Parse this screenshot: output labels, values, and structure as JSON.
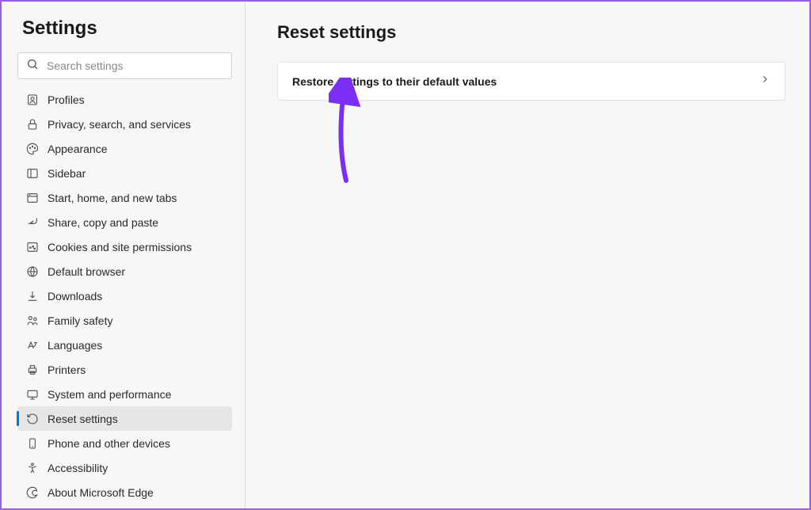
{
  "sidebar": {
    "title": "Settings",
    "search_placeholder": "Search settings",
    "items": [
      {
        "label": "Profiles",
        "icon": "profiles-icon"
      },
      {
        "label": "Privacy, search, and services",
        "icon": "lock-icon"
      },
      {
        "label": "Appearance",
        "icon": "appearance-icon"
      },
      {
        "label": "Sidebar",
        "icon": "sidebar-icon"
      },
      {
        "label": "Start, home, and new tabs",
        "icon": "start-icon"
      },
      {
        "label": "Share, copy and paste",
        "icon": "share-icon"
      },
      {
        "label": "Cookies and site permissions",
        "icon": "cookies-icon"
      },
      {
        "label": "Default browser",
        "icon": "browser-icon"
      },
      {
        "label": "Downloads",
        "icon": "download-icon"
      },
      {
        "label": "Family safety",
        "icon": "family-icon"
      },
      {
        "label": "Languages",
        "icon": "languages-icon"
      },
      {
        "label": "Printers",
        "icon": "printers-icon"
      },
      {
        "label": "System and performance",
        "icon": "system-icon"
      },
      {
        "label": "Reset settings",
        "icon": "reset-icon",
        "active": true
      },
      {
        "label": "Phone and other devices",
        "icon": "phone-icon"
      },
      {
        "label": "Accessibility",
        "icon": "accessibility-icon"
      },
      {
        "label": "About Microsoft Edge",
        "icon": "edge-icon"
      }
    ]
  },
  "main": {
    "title": "Reset settings",
    "card_label": "Restore settings to their default values"
  },
  "annotation": {
    "arrow_color": "#7b2ff2"
  }
}
